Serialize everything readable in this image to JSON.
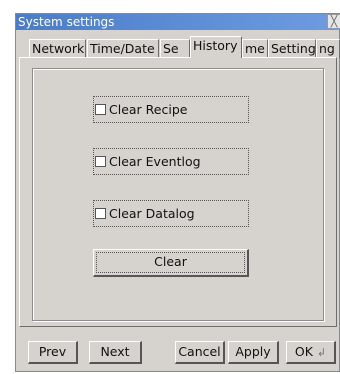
{
  "window": {
    "title": "System settings",
    "close_glyph": "╳"
  },
  "tabs": [
    {
      "label": "Network"
    },
    {
      "label": "Time/Date"
    },
    {
      "label": "Se"
    },
    {
      "label": "History",
      "active": true
    },
    {
      "label": "me"
    },
    {
      "label": "Setting"
    },
    {
      "label": "ng"
    }
  ],
  "options": [
    {
      "label": "Clear Recipe",
      "checked": false
    },
    {
      "label": "Clear Eventlog",
      "checked": false
    },
    {
      "label": "Clear Datalog",
      "checked": false
    }
  ],
  "clear_button": {
    "label": "Clear"
  },
  "footer": {
    "prev_label": "Prev",
    "next_label": "Next",
    "cancel_label": "Cancel",
    "apply_label": "Apply",
    "ok_label": "OK",
    "ok_icon": "enter-icon"
  }
}
